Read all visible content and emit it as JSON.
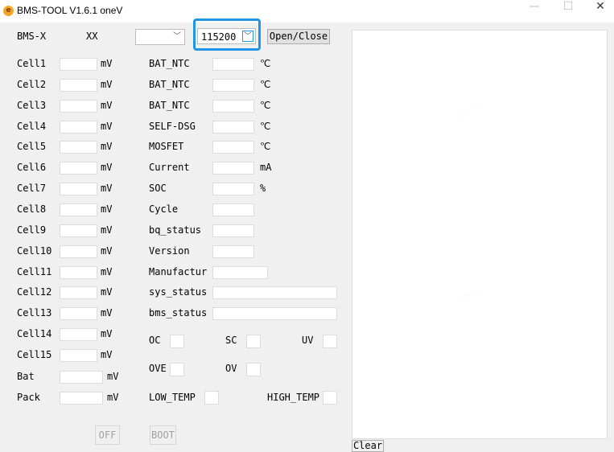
{
  "window": {
    "title": "BMS-TOOL V1.6.1  oneV",
    "icon": "app-logo-icon",
    "controls": {
      "minimize": "—",
      "maximize": "☐",
      "close": "✕"
    }
  },
  "header": {
    "device_label": "BMS-X",
    "device_value": "XX",
    "port_select_value": "",
    "baud_select_value": "115200",
    "open_close_label": "Open/Close"
  },
  "cells": [
    {
      "label": "Cell1",
      "value": "",
      "unit": "mV"
    },
    {
      "label": "Cell2",
      "value": "",
      "unit": "mV"
    },
    {
      "label": "Cell3",
      "value": "",
      "unit": "mV"
    },
    {
      "label": "Cell4",
      "value": "",
      "unit": "mV"
    },
    {
      "label": "Cell5",
      "value": "",
      "unit": "mV"
    },
    {
      "label": "Cell6",
      "value": "",
      "unit": "mV"
    },
    {
      "label": "Cell7",
      "value": "",
      "unit": "mV"
    },
    {
      "label": "Cell8",
      "value": "",
      "unit": "mV"
    },
    {
      "label": "Cell9",
      "value": "",
      "unit": "mV"
    },
    {
      "label": "Cell10",
      "value": "",
      "unit": "mV"
    },
    {
      "label": "Cell11",
      "value": "",
      "unit": "mV"
    },
    {
      "label": "Cell12",
      "value": "",
      "unit": "mV"
    },
    {
      "label": "Cell13",
      "value": "",
      "unit": "mV"
    },
    {
      "label": "Cell14",
      "value": "",
      "unit": "mV"
    },
    {
      "label": "Cell15",
      "value": "",
      "unit": "mV"
    }
  ],
  "pack": [
    {
      "label": "Bat",
      "value": "",
      "unit": "mV"
    },
    {
      "label": "Pack",
      "value": "",
      "unit": "mV"
    }
  ],
  "status": [
    {
      "label": "BAT_NTC",
      "value": "",
      "unit": "℃"
    },
    {
      "label": "BAT_NTC",
      "value": "",
      "unit": "℃"
    },
    {
      "label": "BAT_NTC",
      "value": "",
      "unit": "℃"
    },
    {
      "label": "SELF-DSG",
      "value": "",
      "unit": "℃"
    },
    {
      "label": "MOSFET",
      "value": "",
      "unit": "℃"
    },
    {
      "label": "Current",
      "value": "",
      "unit": "mA"
    },
    {
      "label": "SOC",
      "value": "",
      "unit": "%"
    },
    {
      "label": "Cycle",
      "value": "",
      "unit": ""
    },
    {
      "label": "bq_status",
      "value": "",
      "unit": ""
    },
    {
      "label": "Version",
      "value": "",
      "unit": ""
    },
    {
      "label": "Manufactur",
      "value": "",
      "unit": ""
    },
    {
      "label": "sys_status",
      "value": "",
      "unit": ""
    },
    {
      "label": "bms_status",
      "value": "",
      "unit": ""
    }
  ],
  "flags": {
    "oc": "OC",
    "sc": "SC",
    "uv": "UV",
    "ove": "OVE",
    "ov": "OV",
    "low_temp": "LOW_TEMP",
    "high_temp": "HIGH_TEMP"
  },
  "buttons": {
    "off": "OFF",
    "boot": "BOOT",
    "clear": "Clear"
  },
  "colors": {
    "focus": "#2196e8",
    "background": "#f0f0f0"
  }
}
